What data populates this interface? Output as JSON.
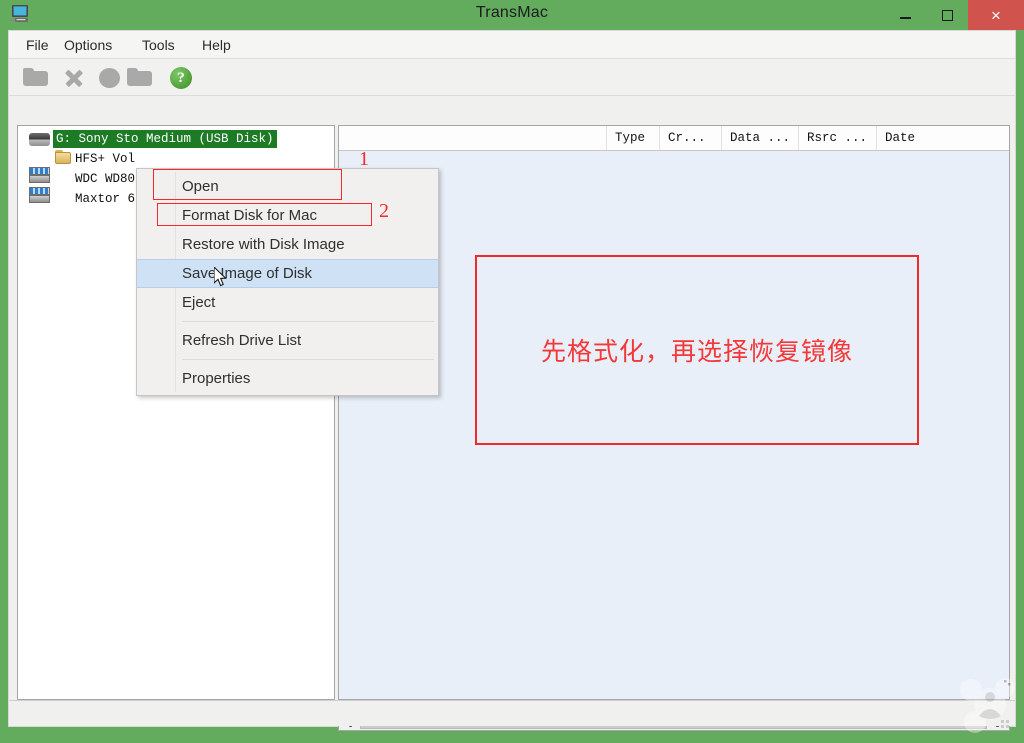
{
  "window": {
    "title": "TransMac",
    "icon": "computer-icon",
    "controls": {
      "minimize": "–",
      "maximize": "□",
      "close": "×"
    },
    "titlebar_color": "#63ac5d",
    "close_color": "#d0534e"
  },
  "menubar": {
    "items": [
      {
        "label": "File"
      },
      {
        "label": "Options"
      },
      {
        "label": "Tools"
      },
      {
        "label": "Help"
      }
    ]
  },
  "toolbar": {
    "buttons": [
      {
        "icon": "folder-icon",
        "label": ""
      },
      {
        "icon": "close-x-icon",
        "label": ""
      },
      {
        "icon": "disk-icon",
        "label": ""
      },
      {
        "icon": "folder-icon",
        "label": ""
      },
      {
        "icon": "help-icon",
        "label": "?"
      }
    ]
  },
  "tree": {
    "items": [
      {
        "label": "G: Sony Sto        Medium  (USB Disk)",
        "icon": "removable-drive-icon",
        "selected": true
      },
      {
        "label": "HFS+ Vol",
        "icon": "folder-icon",
        "selected": false
      },
      {
        "label": "WDC WD80",
        "icon": "hard-drive-icon",
        "selected": false
      },
      {
        "label": "Maxtor 6",
        "icon": "hard-drive-icon",
        "selected": false
      }
    ]
  },
  "file_list": {
    "columns": [
      {
        "label": "Type"
      },
      {
        "label": "Cr..."
      },
      {
        "label": "Data ..."
      },
      {
        "label": "Rsrc ..."
      },
      {
        "label": "Date"
      }
    ],
    "rows": []
  },
  "context_menu": {
    "items": [
      {
        "label": "Open",
        "selected": false,
        "separator_after": false
      },
      {
        "label": "Format Disk for Mac",
        "selected": false,
        "separator_after": false
      },
      {
        "label": "Restore with Disk Image",
        "selected": false,
        "separator_after": false
      },
      {
        "label": "Save Image of Disk",
        "selected": true,
        "separator_after": false
      },
      {
        "label": "Eject",
        "selected": false,
        "separator_after": true
      },
      {
        "label": "Refresh Drive List",
        "selected": false,
        "separator_after": true
      },
      {
        "label": "Properties",
        "selected": false,
        "separator_after": false
      }
    ]
  },
  "annotations": {
    "number_1": "1",
    "number_2": "2",
    "note_text": "先格式化，再选择恢复镜像",
    "color": "#f22a2a"
  },
  "scrollbar": {
    "left_arrow": "❮",
    "right_arrow": "❯"
  }
}
